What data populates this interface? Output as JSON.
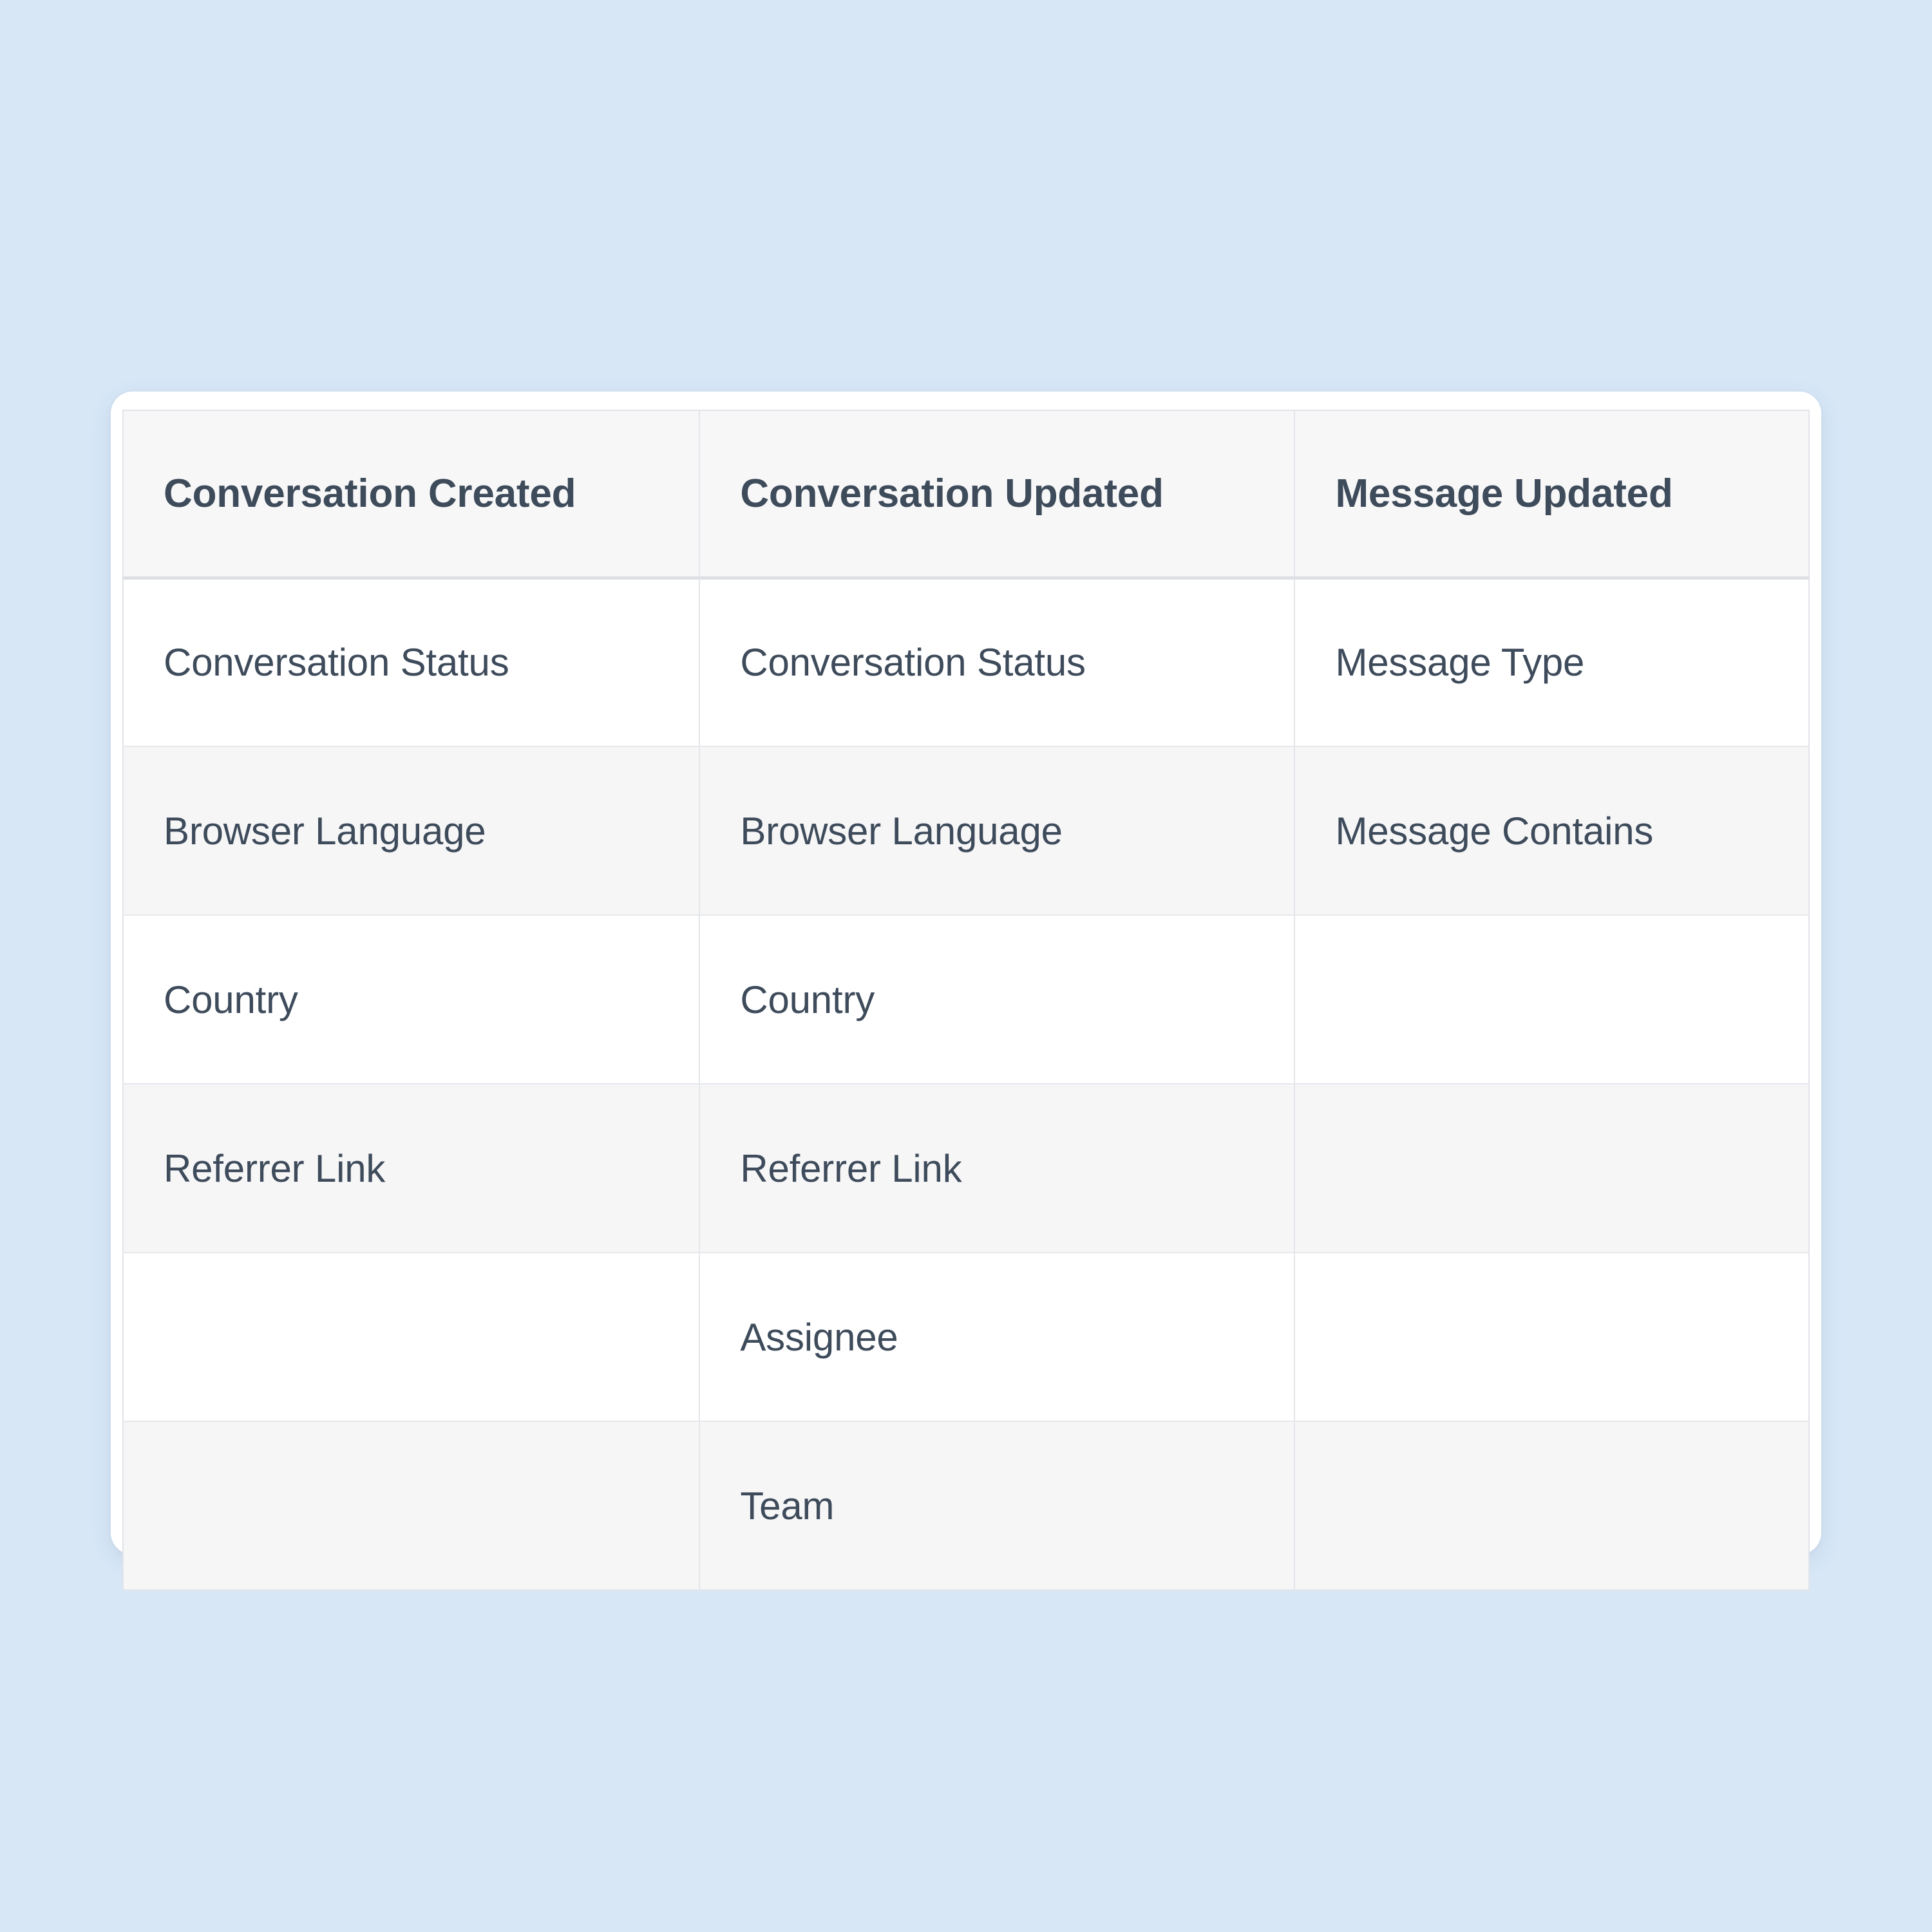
{
  "theme": {
    "page_background": "#d7e7f6",
    "card_background": "#ffffff",
    "header_background": "#f7f7f8",
    "row_alt_background": "#f6f6f7",
    "row_background": "#ffffff",
    "border_color": "#e4e6ea",
    "header_border_color": "#dddfe4",
    "text_color": "#3e4b5b"
  },
  "table": {
    "headers": [
      "Conversation Created",
      "Conversation Updated",
      "Message Updated"
    ],
    "rows": [
      [
        "Conversation Status",
        "Conversation Status",
        "Message Type"
      ],
      [
        "Browser Language",
        "Browser Language",
        "Message Contains"
      ],
      [
        "Country",
        "Country",
        ""
      ],
      [
        "Referrer Link",
        "Referrer Link",
        ""
      ],
      [
        "",
        "Assignee",
        ""
      ],
      [
        "",
        "Team",
        ""
      ]
    ]
  },
  "chart_data": {
    "type": "table",
    "title": "",
    "columns": [
      "Conversation Created",
      "Conversation Updated",
      "Message Updated"
    ],
    "data": [
      [
        "Conversation Status",
        "Conversation Status",
        "Message Type"
      ],
      [
        "Browser Language",
        "Browser Language",
        "Message Contains"
      ],
      [
        "Country",
        "Country",
        ""
      ],
      [
        "Referrer Link",
        "Referrer Link",
        ""
      ],
      [
        "",
        "Assignee",
        ""
      ],
      [
        "",
        "Team",
        ""
      ]
    ]
  }
}
